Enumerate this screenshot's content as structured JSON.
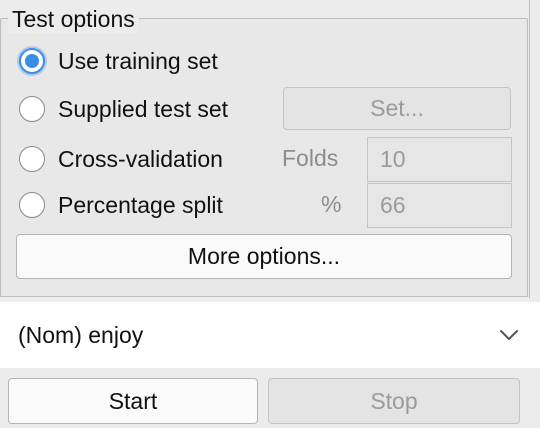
{
  "test_options": {
    "title": "Test options",
    "radio_use_training": "Use training set",
    "radio_supplied_test": "Supplied test set",
    "set_button": "Set...",
    "radio_cross_validation": "Cross-validation",
    "folds_label": "Folds",
    "folds_value": "10",
    "radio_percentage_split": "Percentage split",
    "percent_label": "%",
    "percent_value": "66",
    "more_options": "More options...",
    "selected": "Use training set"
  },
  "class_selector": {
    "value": "(Nom) enjoy",
    "icon": "chevron-down-icon"
  },
  "actions": {
    "start": "Start",
    "stop": "Stop"
  },
  "colors": {
    "accent": "#3b8ee8",
    "disabled_text": "#9b9b9b"
  }
}
